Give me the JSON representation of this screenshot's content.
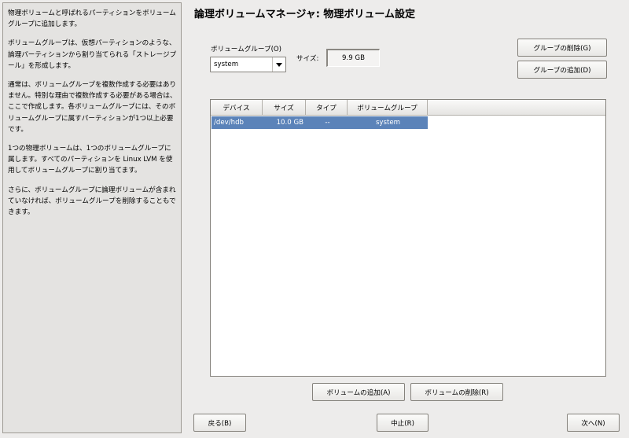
{
  "help": {
    "paragraphs": [
      "物理ボリュームと呼ばれるパーティションをボリュームグループに追加します。",
      "ボリュームグループは、仮想パーティションのような、論理パーティションから割り当てられる「ストレージプール」を形成します。",
      "通常は、ボリュームグループを複数作成する必要はありません。特別な理由で複数作成する必要がある場合は、ここで作成します。各ボリュームグループには、そのボリュームグループに属すパーティションが1つ以上必要です。",
      "1つの物理ボリュームは、1つのボリュームグループに属します。すべてのパーティションを Linux LVM を使用してボリュームグループに割り当てます。",
      "さらに、ボリュームグループに論理ボリュームが含まれていなければ、ボリュームグループを削除することもできます。"
    ]
  },
  "title": "論理ボリュームマネージャ: 物理ボリューム設定",
  "volume_group": {
    "label": "ボリュームグループ(O)",
    "selected": "system"
  },
  "size": {
    "label": "サイズ:",
    "value": "9.9 GB"
  },
  "buttons": {
    "delete_group": "グループの削除(G)",
    "add_group": "グループの追加(D)",
    "add_volume": "ボリュームの追加(A)",
    "remove_volume": "ボリュームの削除(R)",
    "back": "戻る(B)",
    "abort": "中止(R)",
    "next": "次へ(N)"
  },
  "table": {
    "columns": [
      "デバイス",
      "サイズ",
      "タイプ",
      "ボリュームグループ"
    ],
    "rows": [
      {
        "device": "/dev/hdb",
        "size": "10.0 GB",
        "type": "--",
        "volume_group": "system",
        "selected": true
      }
    ]
  },
  "colors": {
    "selection": "#5b83b9",
    "background": "#edeceb"
  },
  "icons": {
    "combo_arrow": "chevron-down-icon"
  }
}
